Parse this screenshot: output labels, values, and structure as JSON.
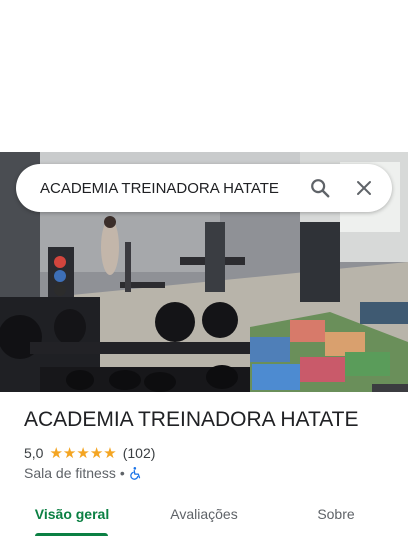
{
  "search": {
    "query": "ACADEMIA TREINADORA HATATE"
  },
  "place": {
    "name": "ACADEMIA TREINADORA HATATE",
    "rating": "5,0",
    "review_count": "(102)",
    "stars_filled": 5,
    "category": "Sala de fitness",
    "separator": "•"
  },
  "tabs": [
    {
      "label": "Visão geral",
      "active": true
    },
    {
      "label": "Avaliações",
      "active": false
    },
    {
      "label": "Sobre",
      "active": false
    }
  ],
  "colors": {
    "accent": "#0b8043",
    "star": "#f4a522",
    "accessibility": "#1a73e8"
  },
  "icons": {
    "search": "search-icon",
    "close": "close-icon",
    "star": "star-icon",
    "accessibility": "wheelchair-icon"
  }
}
